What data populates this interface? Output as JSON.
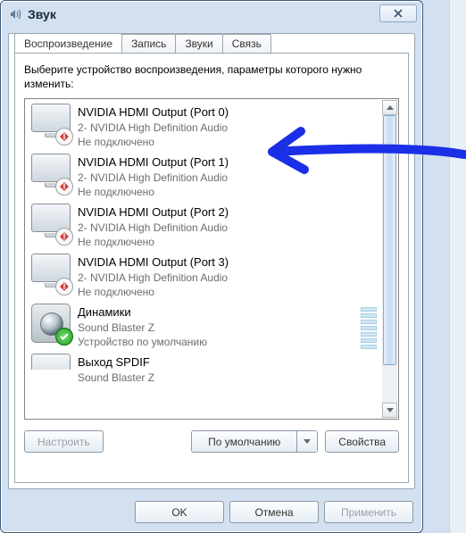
{
  "window": {
    "title": "Звук"
  },
  "tabs": [
    {
      "label": "Воспроизведение",
      "active": true
    },
    {
      "label": "Запись",
      "active": false
    },
    {
      "label": "Звуки",
      "active": false
    },
    {
      "label": "Связь",
      "active": false
    }
  ],
  "instruction": "Выберите устройство воспроизведения, параметры которого нужно изменить:",
  "devices": [
    {
      "name": "NVIDIA HDMI Output (Port 0)",
      "desc": "2- NVIDIA High Definition Audio",
      "status": "Не подключено",
      "icon": "monitor",
      "badge": "error"
    },
    {
      "name": "NVIDIA HDMI Output (Port 1)",
      "desc": "2- NVIDIA High Definition Audio",
      "status": "Не подключено",
      "icon": "monitor",
      "badge": "error"
    },
    {
      "name": "NVIDIA HDMI Output (Port 2)",
      "desc": "2- NVIDIA High Definition Audio",
      "status": "Не подключено",
      "icon": "monitor",
      "badge": "error"
    },
    {
      "name": "NVIDIA HDMI Output (Port 3)",
      "desc": "2- NVIDIA High Definition Audio",
      "status": "Не подключено",
      "icon": "monitor",
      "badge": "error"
    },
    {
      "name": "Динамики",
      "desc": "Sound Blaster Z",
      "status": "Устройство по умолчанию",
      "icon": "speaker",
      "badge": "ok",
      "meter": true
    },
    {
      "name": "Выход SPDIF",
      "desc": "Sound Blaster Z",
      "status": "",
      "icon": "digital",
      "badge": "",
      "truncated": true
    }
  ],
  "buttons": {
    "configure": "Настроить",
    "default": "По умолчанию",
    "properties": "Свойства",
    "ok": "OK",
    "cancel": "Отмена",
    "apply": "Применить"
  }
}
